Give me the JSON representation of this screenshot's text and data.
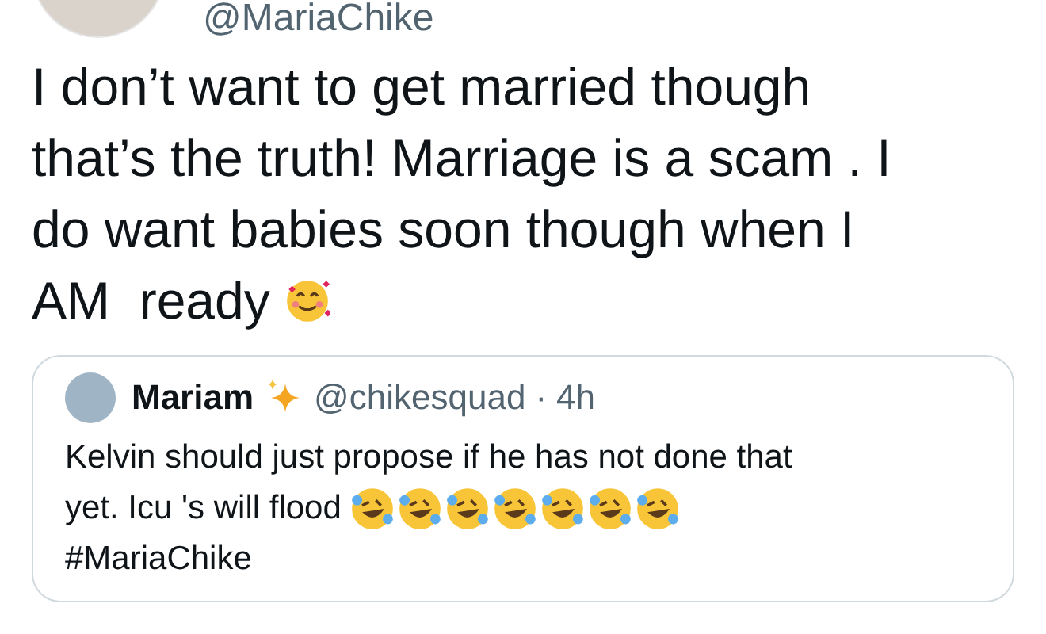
{
  "tweet": {
    "handle": "@MariaChike",
    "lines": [
      "I don’t want to get married though",
      "that’s the truth! Marriage is a scam . I",
      "do want babies soon though when I",
      "AM  ready"
    ]
  },
  "quoted_tweet": {
    "name": "Mariam",
    "handle": "@chikesquad",
    "separator": "·",
    "time": "4h",
    "lines": [
      "Kelvin should just propose if he has not done that",
      "yet. Icu 's will flood"
    ],
    "hashtag": "#MariaChike"
  }
}
